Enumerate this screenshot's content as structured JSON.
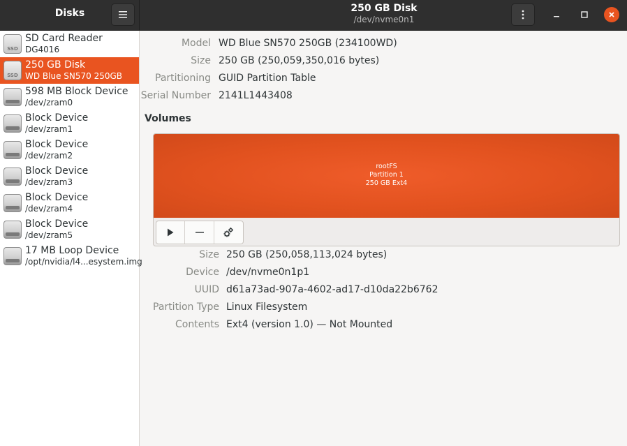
{
  "header": {
    "app_title": "Disks",
    "disk_title": "250 GB Disk",
    "disk_subtitle": "/dev/nvme0n1",
    "menu_icon": "hamburger-menu-icon",
    "kebab_icon": "vertical-dots-icon"
  },
  "window_controls": {
    "minimize": "–",
    "maximize": "□",
    "close": "✕"
  },
  "sidebar": {
    "items": [
      {
        "name": "SD Card Reader",
        "sub": "DG4016",
        "icon": "ssd",
        "icon_label": "SSD"
      },
      {
        "name": "250 GB Disk",
        "sub": "WD Blue SN570 250GB",
        "icon": "ssd",
        "icon_label": "SSD"
      },
      {
        "name": "598 MB Block Device",
        "sub": "/dev/zram0",
        "icon": "hdd"
      },
      {
        "name": "Block Device",
        "sub": "/dev/zram1",
        "icon": "hdd"
      },
      {
        "name": "Block Device",
        "sub": "/dev/zram2",
        "icon": "hdd"
      },
      {
        "name": "Block Device",
        "sub": "/dev/zram3",
        "icon": "hdd"
      },
      {
        "name": "Block Device",
        "sub": "/dev/zram4",
        "icon": "hdd"
      },
      {
        "name": "Block Device",
        "sub": "/dev/zram5",
        "icon": "hdd"
      },
      {
        "name": "17 MB Loop Device",
        "sub": "/opt/nvidia/l4...esystem.img",
        "icon": "hdd"
      }
    ]
  },
  "disk_info": {
    "model_label": "Model",
    "model": "WD Blue SN570 250GB (234100WD)",
    "size_label": "Size",
    "size": "250 GB (250,059,350,016 bytes)",
    "partitioning_label": "Partitioning",
    "partitioning": "GUID Partition Table",
    "serial_label": "Serial Number",
    "serial": "2141L1443408"
  },
  "volumes": {
    "title": "Volumes",
    "partition": {
      "line1": "rootFS",
      "line2": "Partition 1",
      "line3": "250 GB Ext4"
    },
    "toolbar": {
      "mount_icon": "play-icon",
      "delete_icon": "minus-icon",
      "options_icon": "gears-icon"
    }
  },
  "volume_info": {
    "size_label": "Size",
    "size": "250 GB (250,058,113,024 bytes)",
    "device_label": "Device",
    "device": "/dev/nvme0n1p1",
    "uuid_label": "UUID",
    "uuid": "d61a73ad-907a-4602-ad17-d10da22b6762",
    "type_label": "Partition Type",
    "type": "Linux Filesystem",
    "contents_label": "Contents",
    "contents": "Ext4 (version 1.0) — Not Mounted"
  },
  "colors": {
    "accent": "#e95420",
    "headerbar": "#2f2f2f"
  }
}
